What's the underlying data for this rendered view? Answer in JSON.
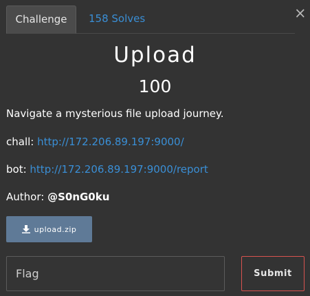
{
  "modal": {
    "close_label": "×"
  },
  "tabs": {
    "challenge": "Challenge",
    "solves": "158 Solves"
  },
  "challenge": {
    "title": "Upload",
    "points": "100",
    "description": "Navigate a mysterious file upload journey.",
    "chall_label": "chall:",
    "chall_url": "http://172.206.89.197:9000/",
    "bot_label": "bot:",
    "bot_url": "http://172.206.89.197:9000/report",
    "author_label": "Author:",
    "author_name": "@S0nG0ku"
  },
  "files": {
    "download_label": "upload.zip"
  },
  "form": {
    "flag_placeholder": "Flag",
    "submit_label": "Submit"
  },
  "colors": {
    "background": "#333333",
    "link": "#3a8fd6",
    "download_button": "#5f7a97",
    "submit_border": "#d9534f"
  }
}
